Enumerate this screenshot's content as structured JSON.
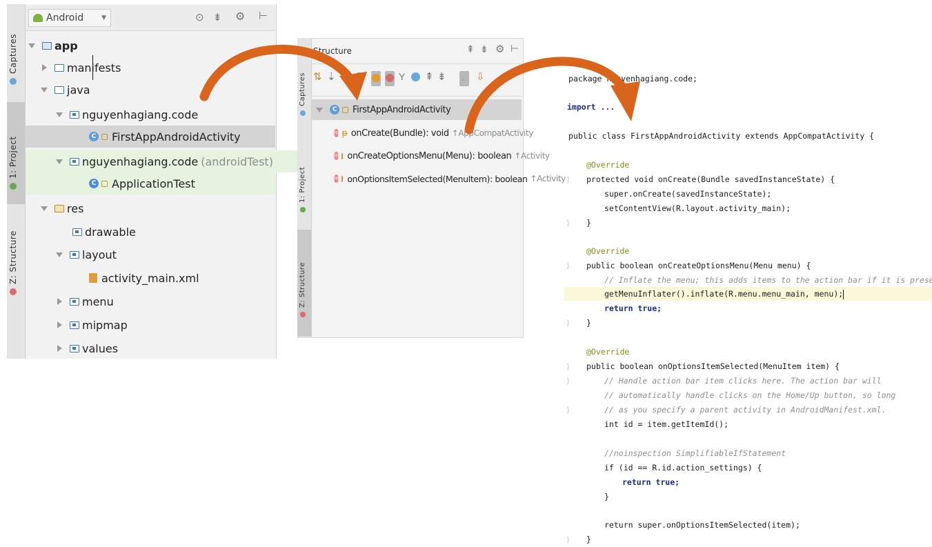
{
  "project_panel": {
    "view_selector": "Android",
    "side_tabs": [
      "Captures",
      "1: Project",
      "Z: Structure"
    ],
    "tree": [
      {
        "label": "app",
        "extra": ""
      },
      {
        "label": "manifests",
        "extra": ""
      },
      {
        "label": "java",
        "extra": ""
      },
      {
        "label": "nguyenhagiang.code",
        "extra": ""
      },
      {
        "label": "FirstAppAndroidActivity",
        "extra": ""
      },
      {
        "label": "nguyenhagiang.code",
        "extra": "(androidTest)"
      },
      {
        "label": "ApplicationTest",
        "extra": ""
      },
      {
        "label": "res",
        "extra": ""
      },
      {
        "label": "drawable",
        "extra": ""
      },
      {
        "label": "layout",
        "extra": ""
      },
      {
        "label": "activity_main.xml",
        "extra": ""
      },
      {
        "label": "menu",
        "extra": ""
      },
      {
        "label": "mipmap",
        "extra": ""
      },
      {
        "label": "values",
        "extra": ""
      }
    ]
  },
  "structure_panel": {
    "title": "Structure",
    "side_tabs": [
      "Captures",
      "1: Project",
      "Z: Structure"
    ],
    "items": [
      {
        "label": "FirstAppAndroidActivity",
        "suffix": ""
      },
      {
        "label": "onCreate(Bundle): void",
        "suffix": "↑AppCompatActivity"
      },
      {
        "label": "onCreateOptionsMenu(Menu): boolean",
        "suffix": "↑Activity"
      },
      {
        "label": "onOptionsItemSelected(MenuItem): boolean",
        "suffix": "↑Activity"
      }
    ]
  },
  "code": {
    "package_line": "package nguyenhagiang.code;",
    "import_line": "import ...",
    "class_line": "public class FirstAppAndroidActivity extends AppCompatActivity {",
    "lines": [
      "@Override",
      "protected void onCreate(Bundle savedInstanceState) {",
      "super.onCreate(savedInstanceState);",
      "setContentView(R.layout.activity_main);",
      "}",
      "@Override",
      "public boolean onCreateOptionsMenu(Menu menu) {",
      "// Inflate the menu; this adds items to the action bar if it is present.",
      "getMenuInflater().inflate(R.menu.menu_main, menu);",
      "return true;",
      "}",
      "@Override",
      "public boolean onOptionsItemSelected(MenuItem item) {",
      "// Handle action bar item clicks here. The action bar will",
      "// automatically handle clicks on the Home/Up button, so long",
      "// as you specify a parent activity in AndroidManifest.xml.",
      "int id = item.getItemId();",
      "//noinspection SimplifiableIfStatement",
      "if (id == R.id.action_settings) {",
      "return true;",
      "}",
      "return super.onOptionsItemSelected(item);",
      "}"
    ]
  },
  "colors": {
    "arrow": "#d9651c",
    "keyword": "#1b2d8c",
    "selection": "#d4d4d4",
    "test_bg": "#e6f3df"
  }
}
